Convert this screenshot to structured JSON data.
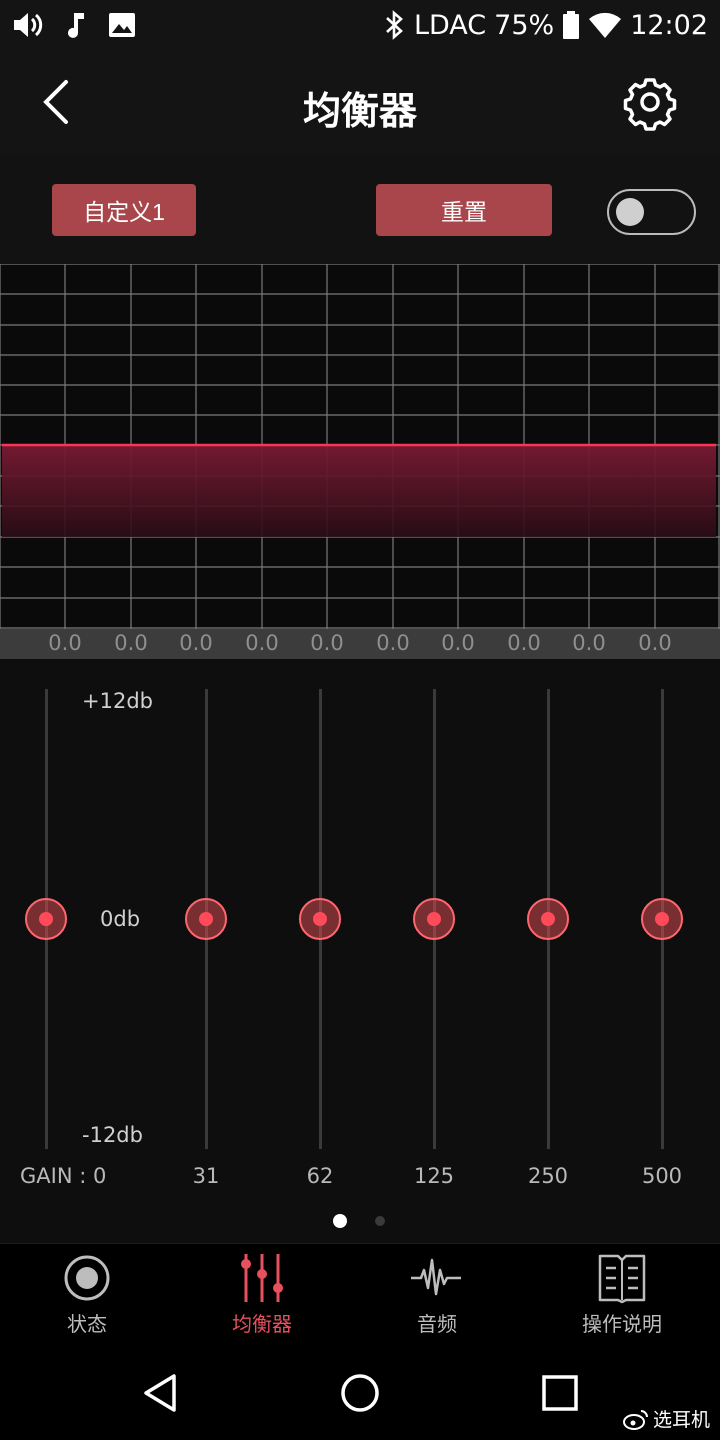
{
  "status_bar": {
    "codec": "LDAC",
    "battery": "75%",
    "time": "12:02",
    "icons": [
      "volume-icon",
      "music-note-icon",
      "image-icon",
      "bluetooth-icon",
      "battery-icon",
      "wifi-icon"
    ]
  },
  "header": {
    "title": "均衡器",
    "back_icon": "back-chevron-icon",
    "settings_icon": "gear-icon"
  },
  "controls": {
    "preset_label": "自定义1",
    "reset_label": "重置",
    "toggle_on": false
  },
  "graph": {
    "band_values": [
      "0.0",
      "0.0",
      "0.0",
      "0.0",
      "0.0",
      "0.0",
      "0.0",
      "0.0",
      "0.0",
      "0.0"
    ]
  },
  "sliders": {
    "db_max": "+12db",
    "db_mid": "0db",
    "db_min": "-12db",
    "gain_label": "GAIN : 0",
    "bands": [
      {
        "freq": "",
        "value_db": 0
      },
      {
        "freq": "31",
        "value_db": 0
      },
      {
        "freq": "62",
        "value_db": 0
      },
      {
        "freq": "125",
        "value_db": 0
      },
      {
        "freq": "250",
        "value_db": 0
      },
      {
        "freq": "500",
        "value_db": 0
      }
    ],
    "page_count": 2,
    "current_page": 1
  },
  "nav": {
    "items": [
      {
        "label": "状态",
        "icon": "record-circle-icon",
        "active": false
      },
      {
        "label": "均衡器",
        "icon": "equalizer-icon",
        "active": true
      },
      {
        "label": "音频",
        "icon": "waveform-icon",
        "active": false
      },
      {
        "label": "操作说明",
        "icon": "book-icon",
        "active": false
      }
    ]
  },
  "watermark": "选耳机",
  "colors": {
    "accent": "#e8505e",
    "button": "#a8464b",
    "curve": "#ff3355"
  }
}
